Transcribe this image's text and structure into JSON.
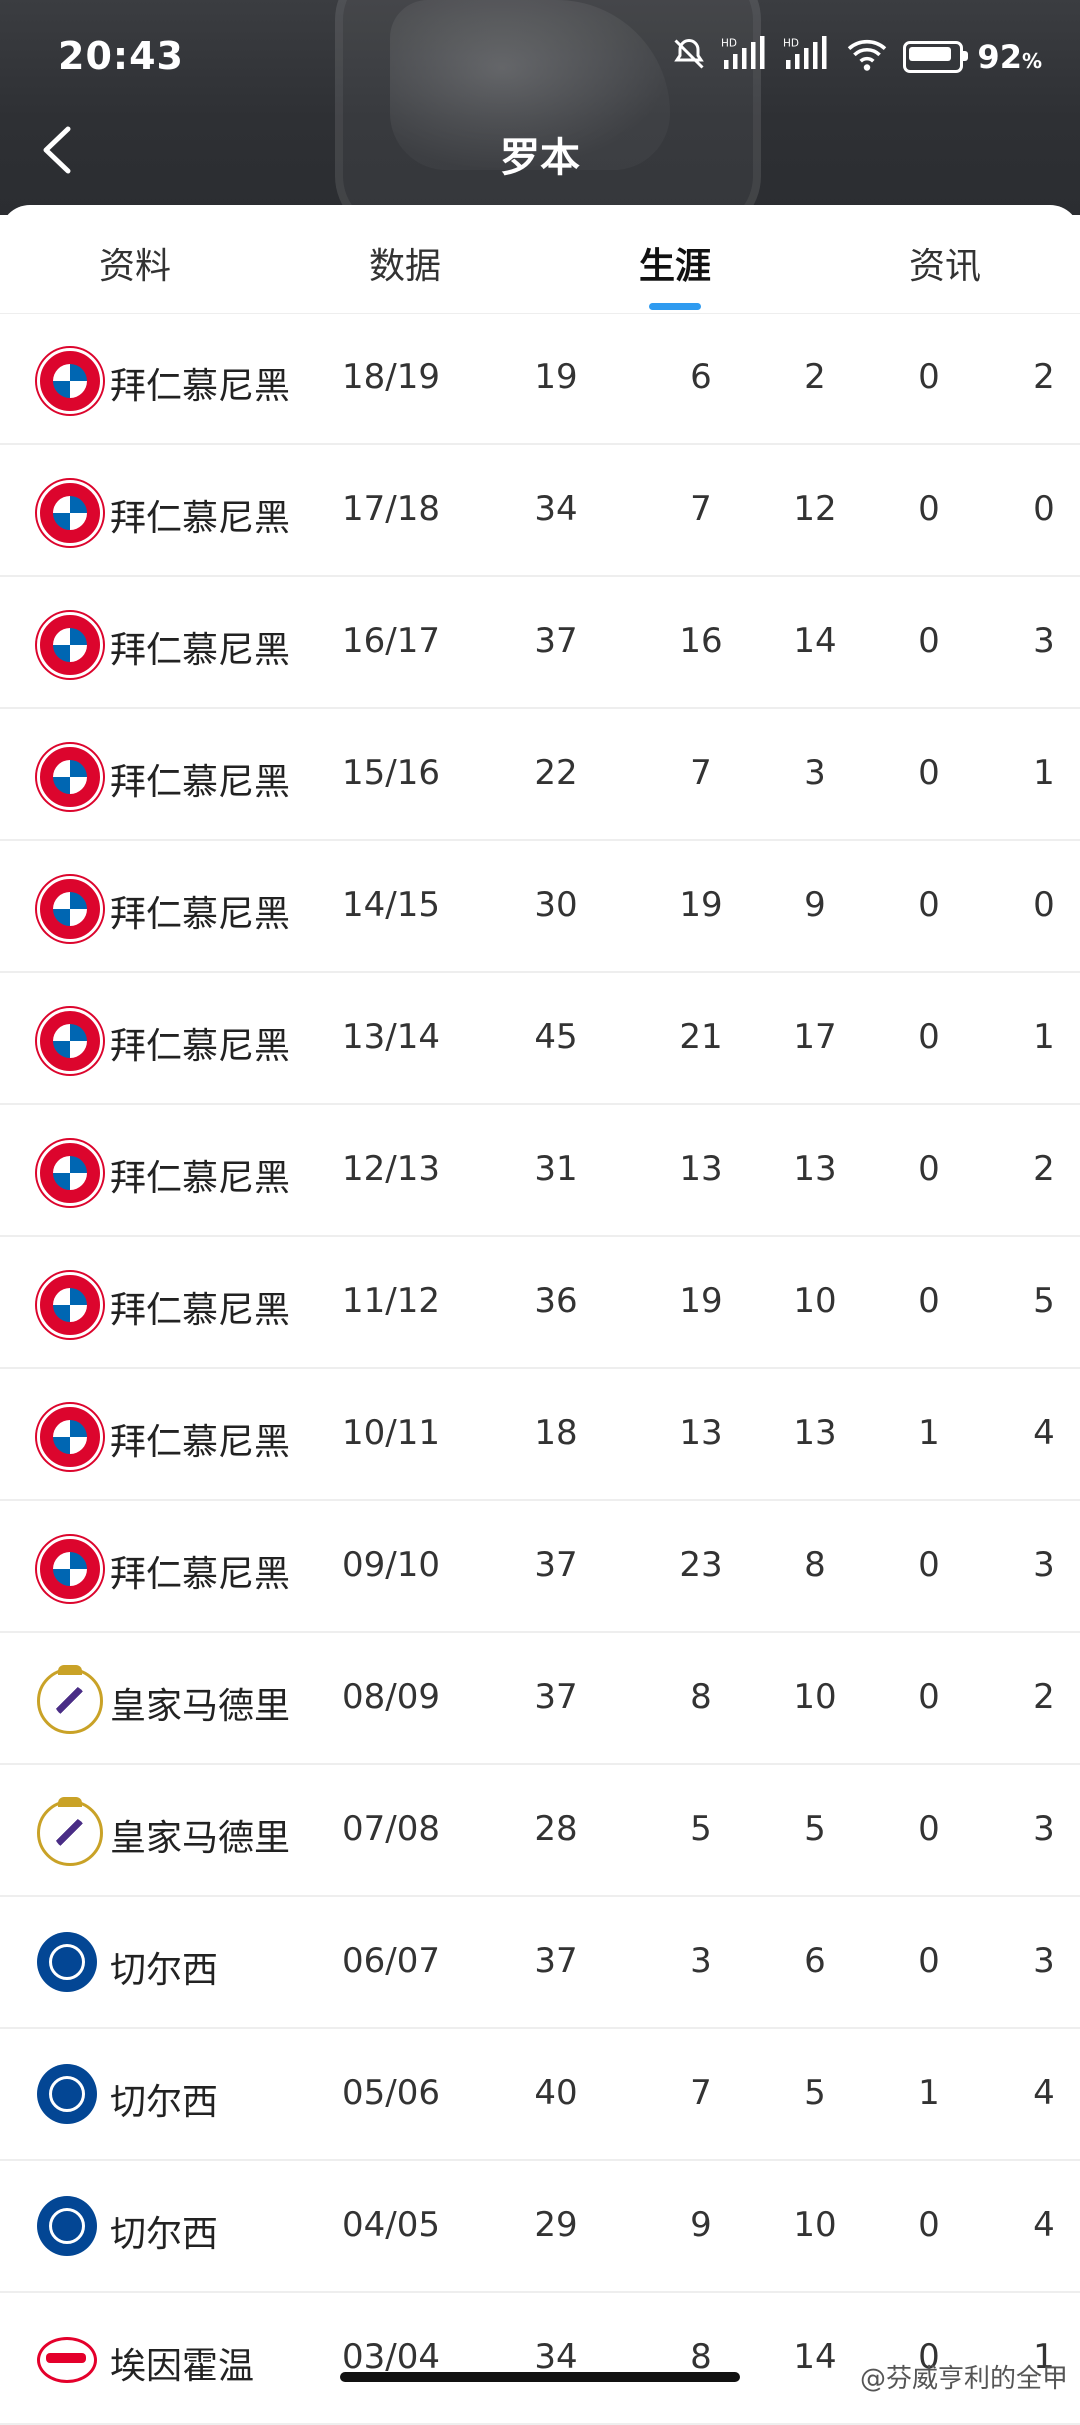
{
  "status_bar": {
    "time": "20:43",
    "battery_percent": "92",
    "battery_unit": "%",
    "icons": [
      "mute-icon",
      "signal-hd-icon",
      "signal-hd-icon",
      "wifi-icon",
      "battery-icon"
    ]
  },
  "header": {
    "title": "罗本"
  },
  "tabs": [
    {
      "label": "资料",
      "active": false
    },
    {
      "label": "数据",
      "active": false
    },
    {
      "label": "生涯",
      "active": true
    },
    {
      "label": "资讯",
      "active": false
    }
  ],
  "career_rows": [
    {
      "club": "拜仁慕尼黑",
      "logo": "bayern",
      "season": "18/19",
      "apps": "19",
      "goals": "6",
      "assists": "2",
      "red": "0",
      "yellow": "2"
    },
    {
      "club": "拜仁慕尼黑",
      "logo": "bayern",
      "season": "17/18",
      "apps": "34",
      "goals": "7",
      "assists": "12",
      "red": "0",
      "yellow": "0"
    },
    {
      "club": "拜仁慕尼黑",
      "logo": "bayern",
      "season": "16/17",
      "apps": "37",
      "goals": "16",
      "assists": "14",
      "red": "0",
      "yellow": "3"
    },
    {
      "club": "拜仁慕尼黑",
      "logo": "bayern",
      "season": "15/16",
      "apps": "22",
      "goals": "7",
      "assists": "3",
      "red": "0",
      "yellow": "1"
    },
    {
      "club": "拜仁慕尼黑",
      "logo": "bayern",
      "season": "14/15",
      "apps": "30",
      "goals": "19",
      "assists": "9",
      "red": "0",
      "yellow": "0"
    },
    {
      "club": "拜仁慕尼黑",
      "logo": "bayern",
      "season": "13/14",
      "apps": "45",
      "goals": "21",
      "assists": "17",
      "red": "0",
      "yellow": "1"
    },
    {
      "club": "拜仁慕尼黑",
      "logo": "bayern",
      "season": "12/13",
      "apps": "31",
      "goals": "13",
      "assists": "13",
      "red": "0",
      "yellow": "2"
    },
    {
      "club": "拜仁慕尼黑",
      "logo": "bayern",
      "season": "11/12",
      "apps": "36",
      "goals": "19",
      "assists": "10",
      "red": "0",
      "yellow": "5"
    },
    {
      "club": "拜仁慕尼黑",
      "logo": "bayern",
      "season": "10/11",
      "apps": "18",
      "goals": "13",
      "assists": "13",
      "red": "1",
      "yellow": "4"
    },
    {
      "club": "拜仁慕尼黑",
      "logo": "bayern",
      "season": "09/10",
      "apps": "37",
      "goals": "23",
      "assists": "8",
      "red": "0",
      "yellow": "3"
    },
    {
      "club": "皇家马德里",
      "logo": "real",
      "season": "08/09",
      "apps": "37",
      "goals": "8",
      "assists": "10",
      "red": "0",
      "yellow": "2"
    },
    {
      "club": "皇家马德里",
      "logo": "real",
      "season": "07/08",
      "apps": "28",
      "goals": "5",
      "assists": "5",
      "red": "0",
      "yellow": "3"
    },
    {
      "club": "切尔西",
      "logo": "chelsea",
      "season": "06/07",
      "apps": "37",
      "goals": "3",
      "assists": "6",
      "red": "0",
      "yellow": "3"
    },
    {
      "club": "切尔西",
      "logo": "chelsea",
      "season": "05/06",
      "apps": "40",
      "goals": "7",
      "assists": "5",
      "red": "1",
      "yellow": "4"
    },
    {
      "club": "切尔西",
      "logo": "chelsea",
      "season": "04/05",
      "apps": "29",
      "goals": "9",
      "assists": "10",
      "red": "0",
      "yellow": "4"
    },
    {
      "club": "埃因霍温",
      "logo": "psv",
      "season": "03/04",
      "apps": "34",
      "goals": "8",
      "assists": "14",
      "red": "0",
      "yellow": "1"
    }
  ],
  "watermark": "@芬威亨利的全甲",
  "colors": {
    "header_bg": "#2e3034",
    "accent": "#2f9bf0",
    "divider": "#eeeeee"
  }
}
